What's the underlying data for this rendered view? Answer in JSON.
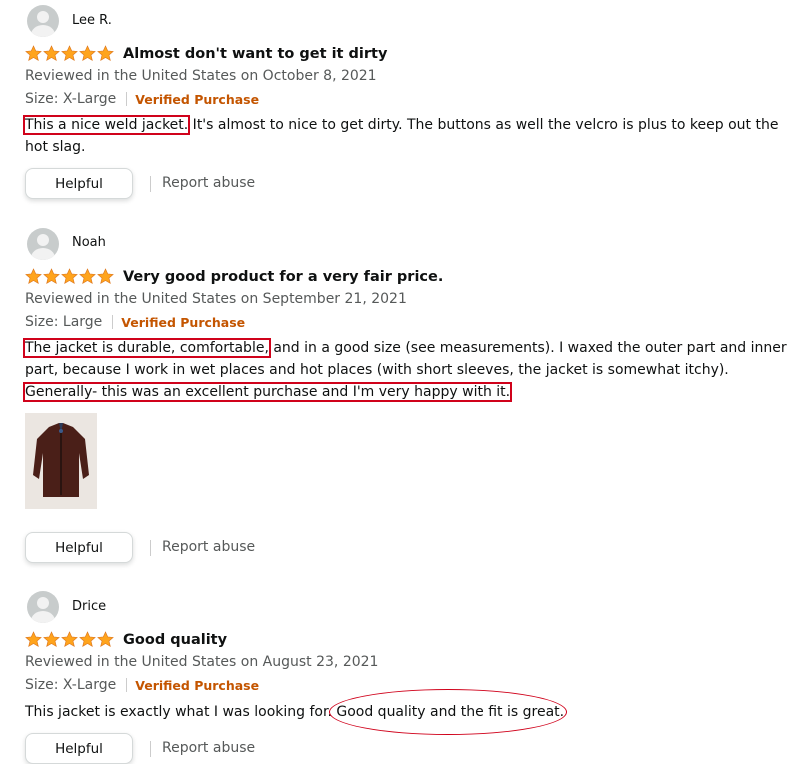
{
  "reviews": [
    {
      "name": "Lee R.",
      "title": "Almost don't want to get it dirty",
      "date": "Reviewed in the United States on October 8, 2021",
      "size": "Size: X-Large",
      "verified": "Verified Purchase",
      "text_hl1": "This a nice weld jacket.",
      "text_rest": " It's almost to nice to get dirty. The buttons as well the velcro is plus to keep out the hot slag.",
      "helpful": "Helpful",
      "report": "Report abuse"
    },
    {
      "name": "Noah",
      "title": "Very good product for a very fair price.",
      "date": "Reviewed in the United States on September 21, 2021",
      "size": "Size: Large",
      "verified": "Verified Purchase",
      "text_hl1": "The jacket is durable, comfortable,",
      "text_mid": " and in a good size (see measurements). I waxed the outer part and inner part, because I work in wet places and hot places (with short sleeves, the jacket is somewhat itchy).",
      "text_hl2": "Generally- this was an excellent purchase and I'm very happy with it.",
      "helpful": "Helpful",
      "report": "Report abuse"
    },
    {
      "name": "Drice",
      "title": "Good quality",
      "date": "Reviewed in the United States on August 23, 2021",
      "size": "Size: X-Large",
      "verified": "Verified Purchase",
      "text_plain": "This jacket is exactly what I was looking for.",
      "text_circled": "Good quality and the fit is great.",
      "helpful": "Helpful",
      "report": "Report abuse"
    }
  ],
  "rating_stars": 5,
  "colors": {
    "star": "#ffa41c",
    "highlight": "#d0021b",
    "verified": "#c45500"
  }
}
